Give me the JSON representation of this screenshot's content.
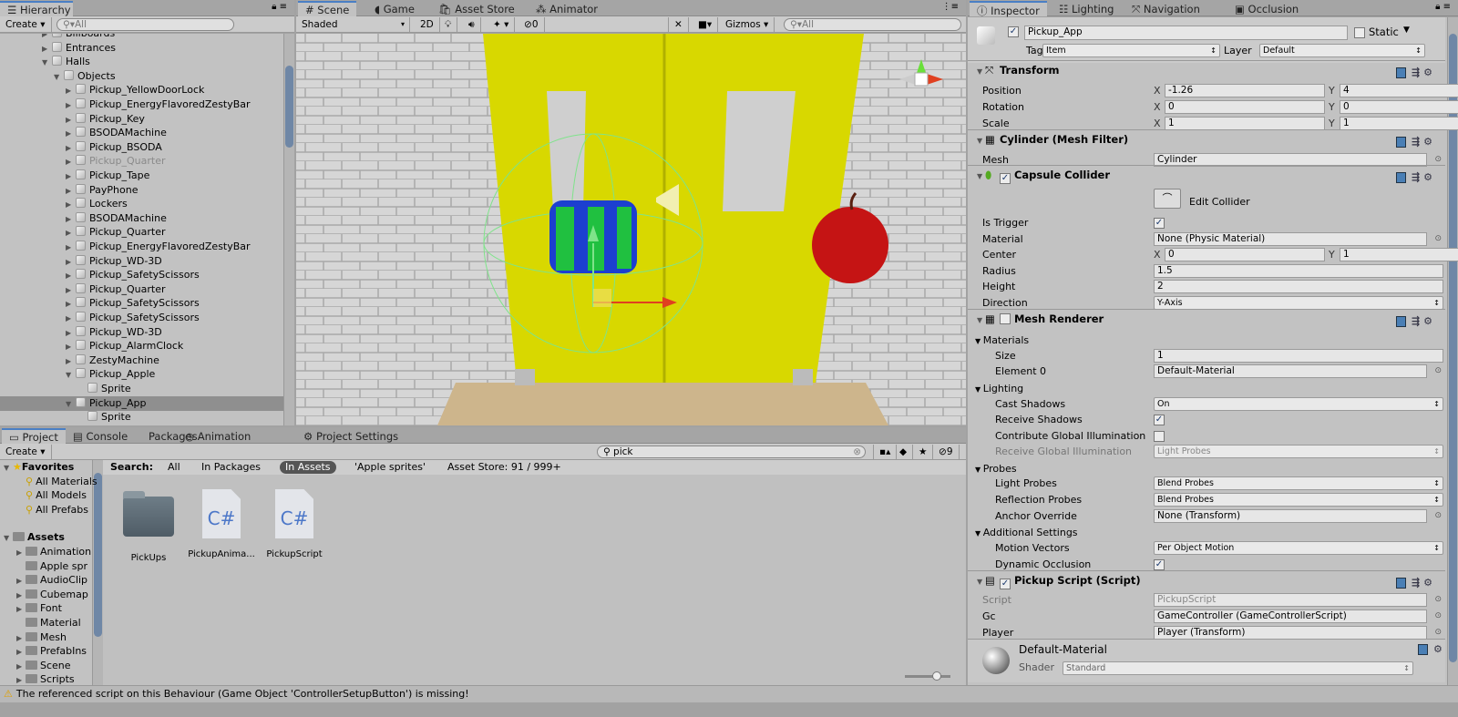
{
  "hierarchy": {
    "tab": "Hierarchy",
    "create": "Create",
    "search_placeholder": "All",
    "items": [
      {
        "label": "Billboards",
        "depth": 0,
        "arrow": "right"
      },
      {
        "label": "Entrances",
        "depth": 0,
        "arrow": "right"
      },
      {
        "label": "Halls",
        "depth": 0,
        "arrow": "down"
      },
      {
        "label": "Objects",
        "depth": 1,
        "arrow": "down"
      },
      {
        "label": "Pickup_YellowDoorLock",
        "depth": 2,
        "arrow": "right"
      },
      {
        "label": "Pickup_EnergyFlavoredZestyBar",
        "depth": 2,
        "arrow": "right"
      },
      {
        "label": "Pickup_Key",
        "depth": 2,
        "arrow": "right"
      },
      {
        "label": "BSODAMachine",
        "depth": 2,
        "arrow": "right"
      },
      {
        "label": "Pickup_BSODA",
        "depth": 2,
        "arrow": "right"
      },
      {
        "label": "Pickup_Quarter",
        "depth": 2,
        "arrow": "right",
        "disabled": true
      },
      {
        "label": "Pickup_Tape",
        "depth": 2,
        "arrow": "right"
      },
      {
        "label": "PayPhone",
        "depth": 2,
        "arrow": "right"
      },
      {
        "label": "Lockers",
        "depth": 2,
        "arrow": "right"
      },
      {
        "label": "BSODAMachine",
        "depth": 2,
        "arrow": "right"
      },
      {
        "label": "Pickup_Quarter",
        "depth": 2,
        "arrow": "right"
      },
      {
        "label": "Pickup_EnergyFlavoredZestyBar",
        "depth": 2,
        "arrow": "right"
      },
      {
        "label": "Pickup_WD-3D",
        "depth": 2,
        "arrow": "right"
      },
      {
        "label": "Pickup_SafetyScissors",
        "depth": 2,
        "arrow": "right"
      },
      {
        "label": "Pickup_Quarter",
        "depth": 2,
        "arrow": "right"
      },
      {
        "label": "Pickup_SafetyScissors",
        "depth": 2,
        "arrow": "right"
      },
      {
        "label": "Pickup_SafetyScissors",
        "depth": 2,
        "arrow": "right"
      },
      {
        "label": "Pickup_WD-3D",
        "depth": 2,
        "arrow": "right"
      },
      {
        "label": "Pickup_AlarmClock",
        "depth": 2,
        "arrow": "right"
      },
      {
        "label": "ZestyMachine",
        "depth": 2,
        "arrow": "right"
      },
      {
        "label": "Pickup_Apple",
        "depth": 2,
        "arrow": "down"
      },
      {
        "label": "Sprite",
        "depth": 3,
        "arrow": null
      },
      {
        "label": "Pickup_App",
        "depth": 2,
        "arrow": "down",
        "selected": true
      },
      {
        "label": "Sprite",
        "depth": 3,
        "arrow": null
      }
    ]
  },
  "scene": {
    "tabs": [
      "Scene",
      "Game",
      "Asset Store",
      "Animator"
    ],
    "shading": "Shaded",
    "mode_2d": "2D",
    "hidden_count": "0",
    "gizmos": "Gizmos",
    "search_placeholder": "All"
  },
  "project": {
    "tabs": [
      "Project",
      "Console",
      "Packages",
      "Animation",
      "Project Settings"
    ],
    "create": "Create",
    "search_value": "pick",
    "filter_count": "9",
    "search_label": "Search:",
    "scopes": [
      "All",
      "In Packages",
      "In Assets",
      "'Apple sprites'"
    ],
    "asset_store": "Asset Store: 91 / 999+",
    "favorites_label": "Favorites",
    "favorites": [
      "All Materials",
      "All Models",
      "All Prefabs"
    ],
    "assets_label": "Assets",
    "folders": [
      "Animation",
      "Apple spr",
      "AudioClip",
      "Cubemap",
      "Font",
      "Material",
      "Mesh",
      "PrefabIns",
      "Scene",
      "Scripts"
    ],
    "results": [
      {
        "name": "PickUps",
        "kind": "folder"
      },
      {
        "name": "PickupAnima...",
        "kind": "cs",
        "glyph": "C#"
      },
      {
        "name": "PickupScript",
        "kind": "cs",
        "glyph": "C#"
      }
    ]
  },
  "status": {
    "message": "The referenced script on this Behaviour (Game Object 'ControllerSetupButton') is missing!",
    "icon": "warning-icon"
  },
  "inspector": {
    "tabs": [
      "Inspector",
      "Lighting",
      "Navigation",
      "Occlusion"
    ],
    "object_name": "Pickup_App",
    "active": true,
    "static_label": "Static",
    "tag_label": "Tag",
    "tag": "Item",
    "layer_label": "Layer",
    "layer": "Default",
    "transform": {
      "title": "Transform",
      "rows": [
        {
          "label": "Position",
          "x": "-1.26",
          "y": "4",
          "z": "42"
        },
        {
          "label": "Rotation",
          "x": "0",
          "y": "0",
          "z": "0"
        },
        {
          "label": "Scale",
          "x": "1",
          "y": "1",
          "z": "1"
        }
      ]
    },
    "mesh_filter": {
      "title": "Cylinder (Mesh Filter)",
      "mesh_label": "Mesh",
      "mesh": "Cylinder"
    },
    "capsule": {
      "title": "Capsule Collider",
      "enabled": true,
      "edit": "Edit Collider",
      "is_trigger_label": "Is Trigger",
      "is_trigger": true,
      "material_label": "Material",
      "material": "None (Physic Material)",
      "center_label": "Center",
      "center": {
        "x": "0",
        "y": "1",
        "z": "0"
      },
      "radius_label": "Radius",
      "radius": "1.5",
      "height_label": "Height",
      "height": "2",
      "direction_label": "Direction",
      "direction": "Y-Axis"
    },
    "mesh_renderer": {
      "title": "Mesh Renderer",
      "enabled": false,
      "materials": "Materials",
      "size_label": "Size",
      "size": "1",
      "element0_label": "Element 0",
      "element0": "Default-Material",
      "lighting": "Lighting",
      "cast_label": "Cast Shadows",
      "cast": "On",
      "receive_label": "Receive Shadows",
      "receive": true,
      "contrib_label": "Contribute Global Illumination",
      "contrib": false,
      "recv_gi_label": "Receive Global Illumination",
      "recv_gi": "Light Probes",
      "probes": "Probes",
      "light_probes_label": "Light Probes",
      "light_probes": "Blend Probes",
      "refl_label": "Reflection Probes",
      "refl": "Blend Probes",
      "anchor_label": "Anchor Override",
      "anchor": "None (Transform)",
      "additional": "Additional Settings",
      "motion_label": "Motion Vectors",
      "motion": "Per Object Motion",
      "dynocc_label": "Dynamic Occlusion",
      "dynocc": true
    },
    "script": {
      "title": "Pickup Script (Script)",
      "enabled": true,
      "script_label": "Script",
      "script": "PickupScript",
      "gc_label": "Gc",
      "gc": "GameController (GameControllerScript)",
      "player_label": "Player",
      "player": "Player (Transform)"
    },
    "material": {
      "name": "Default-Material",
      "shader_label": "Shader",
      "shader": "Standard"
    }
  },
  "colors": {
    "accent": "#4a7fc4",
    "selection": "#8f8f8f",
    "door": "#d8d800"
  }
}
